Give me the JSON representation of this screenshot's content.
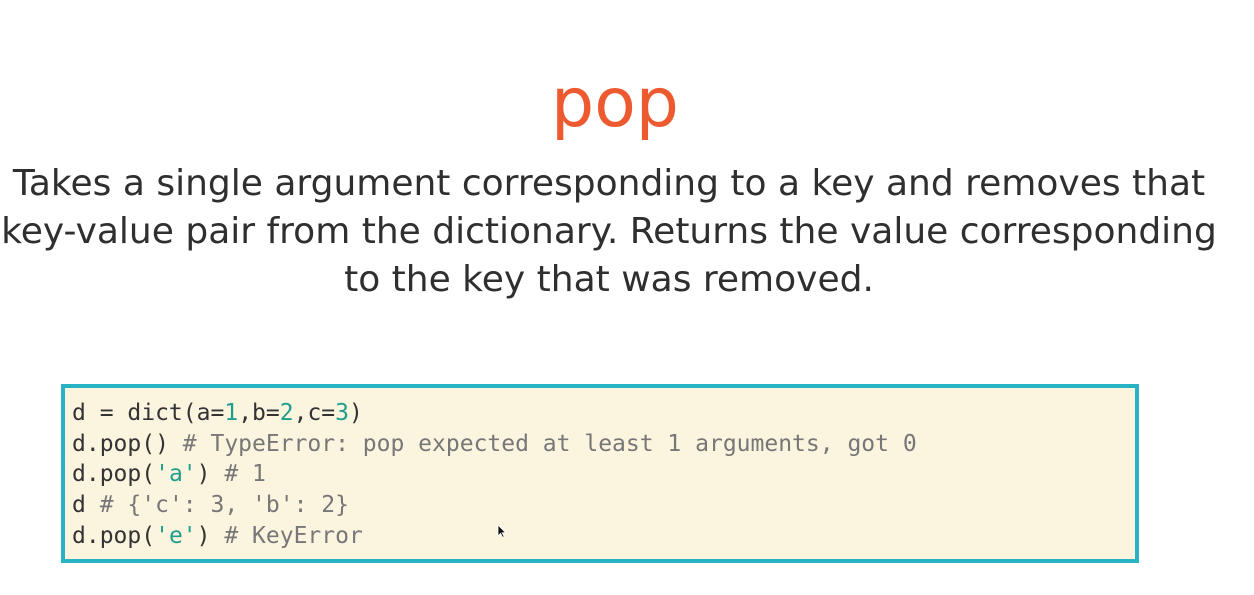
{
  "slide": {
    "title": "pop",
    "description": "Takes a single argument corresponding to a key and removes that key-value pair from the dictionary. Returns the value corresponding to the key that was removed."
  },
  "code": {
    "line1": {
      "a": "d = dict(a=",
      "n1": "1",
      "b": ",b=",
      "n2": "2",
      "c": ",c=",
      "n3": "3",
      "d": ")"
    },
    "line2": {
      "code": "d.pop() ",
      "comment": "# TypeError: pop expected at least 1 arguments, got 0"
    },
    "line3": {
      "a": "d.pop(",
      "s": "'a'",
      "b": ") ",
      "comment": "# 1"
    },
    "line4": {
      "code": "d ",
      "comment": "# {'c': 3, 'b': 2}"
    },
    "line5": {
      "a": "d.pop(",
      "s": "'e'",
      "b": ") ",
      "comment": "# KeyError"
    }
  },
  "colors": {
    "title": "#ee5a30",
    "code_border": "#27b3c3",
    "code_background": "#fbf4df",
    "literal": "#1f9e8a",
    "comment": "#777777"
  },
  "icons": {
    "cursor": "mouse-pointer-icon"
  }
}
